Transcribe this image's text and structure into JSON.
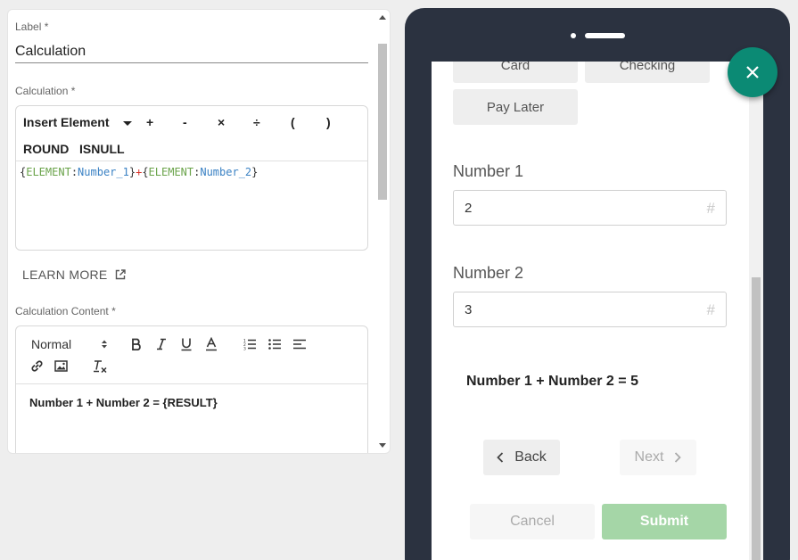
{
  "editor": {
    "label_field": {
      "label": "Label *",
      "value": "Calculation"
    },
    "calculation": {
      "label": "Calculation *",
      "toolbar": {
        "insert_element": "Insert Element",
        "plus": "+",
        "minus": "-",
        "multiply": "×",
        "divide": "÷",
        "open_paren": "(",
        "close_paren": ")",
        "round": "ROUND",
        "isnull": "ISNULL"
      },
      "expression": {
        "t1": "{",
        "t2": "ELEMENT",
        "t3": ":",
        "t4": "Number_1",
        "t5": "}",
        "t6": "+",
        "t7": "{",
        "t8": "ELEMENT",
        "t9": ":",
        "t10": "Number_2",
        "t11": "}"
      }
    },
    "learn_more": "LEARN MORE",
    "calculation_content": {
      "label": "Calculation Content *",
      "format": "Normal",
      "body": "Number 1 + Number 2 = {RESULT}"
    }
  },
  "preview": {
    "payment_options": [
      "Card",
      "Checking",
      "Pay Later"
    ],
    "number1": {
      "label": "Number 1",
      "value": "2"
    },
    "number2": {
      "label": "Number 2",
      "value": "3"
    },
    "result_text": "Number 1 + Number 2 = 5",
    "back": "Back",
    "next": "Next",
    "cancel": "Cancel",
    "submit": "Submit"
  },
  "colors": {
    "phone_frame": "#2b3240",
    "fab": "#0b8a74",
    "submit": "#a5d6a7",
    "keyword": "#6aa34a",
    "element_name": "#3b82c4",
    "operator": "#d9342b"
  }
}
